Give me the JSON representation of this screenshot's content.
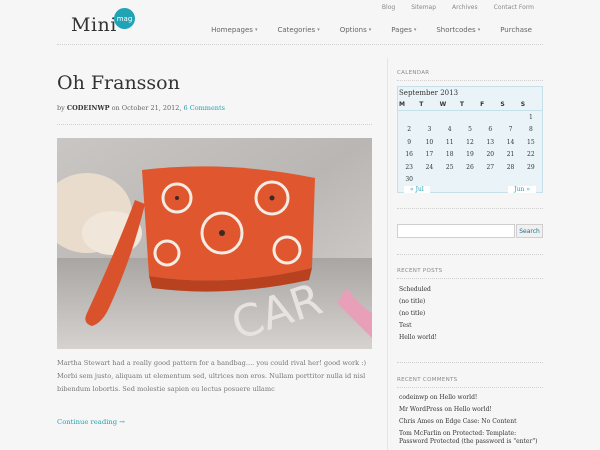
{
  "top_links": [
    "Blog",
    "Sitemap",
    "Archives",
    "Contact Form"
  ],
  "logo": {
    "text": "Mini",
    "badge": "mag"
  },
  "nav": [
    {
      "label": "Homepages",
      "dropdown": true
    },
    {
      "label": "Categories",
      "dropdown": true
    },
    {
      "label": "Options",
      "dropdown": true
    },
    {
      "label": "Pages",
      "dropdown": true
    },
    {
      "label": "Shortcodes",
      "dropdown": true
    },
    {
      "label": "Purchase",
      "dropdown": false
    }
  ],
  "post": {
    "title": "Oh Fransson",
    "by": "by",
    "author": "CODEINWP",
    "on": "on October 21, 2012,",
    "comments": "6 Comments",
    "excerpt": "Martha Stewart had a really good pattern for a handbag.... you could rival her! good work :) Morbi sem justo, aliquam ut elementum sed, ultrices non eros. Nullam porttitor nulla id nisl bibendum lobortis. Sed molestie sapien eu lectus posuere ullamc",
    "continue": "Continue reading →"
  },
  "sidebar": {
    "calendar": {
      "title": "CALENDAR",
      "caption": "September 2013",
      "weekdays": [
        "M",
        "T",
        "W",
        "T",
        "F",
        "S",
        "S"
      ],
      "days": [
        "",
        "",
        "",
        "",
        "",
        "",
        "1",
        "2",
        "3",
        "4",
        "5",
        "6",
        "7",
        "8",
        "9",
        "10",
        "11",
        "12",
        "13",
        "14",
        "15",
        "16",
        "17",
        "18",
        "19",
        "20",
        "21",
        "22",
        "23",
        "24",
        "25",
        "26",
        "27",
        "28",
        "29",
        "30",
        "",
        "",
        "",
        "",
        "",
        ""
      ],
      "prev": "« Jul",
      "next": "Jun »"
    },
    "search": {
      "button": "Search",
      "placeholder": ""
    },
    "recent_posts": {
      "title": "RECENT POSTS",
      "items": [
        "Scheduled",
        "(no title)",
        "(no title)",
        "Test",
        "Hello world!"
      ]
    },
    "recent_comments": {
      "title": "RECENT COMMENTS",
      "items": [
        "codeinwp on Hello world!",
        "Mr WordPress on Hello world!",
        "Chris Ames on Edge Case: No Content",
        "Tom McFarlin on Protected: Template: Password Protected (the password is \"enter\")"
      ]
    }
  },
  "colors": {
    "accent": "#1fa3b5",
    "bag": "#e0562e"
  }
}
